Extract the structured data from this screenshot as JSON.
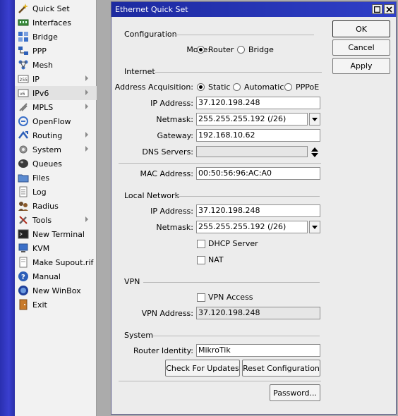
{
  "menu": [
    {
      "label": "Quick Set",
      "icon": "wand-icon",
      "arrow": false
    },
    {
      "label": "Interfaces",
      "icon": "interfaces-icon",
      "arrow": false
    },
    {
      "label": "Bridge",
      "icon": "bridge-icon",
      "arrow": false
    },
    {
      "label": "PPP",
      "icon": "ppp-icon",
      "arrow": false
    },
    {
      "label": "Mesh",
      "icon": "mesh-icon",
      "arrow": false
    },
    {
      "label": "IP",
      "icon": "ip-icon",
      "arrow": true
    },
    {
      "label": "IPv6",
      "icon": "ipv6-icon",
      "arrow": true
    },
    {
      "label": "MPLS",
      "icon": "mpls-icon",
      "arrow": true
    },
    {
      "label": "OpenFlow",
      "icon": "openflow-icon",
      "arrow": false
    },
    {
      "label": "Routing",
      "icon": "routing-icon",
      "arrow": true
    },
    {
      "label": "System",
      "icon": "gear-icon",
      "arrow": true
    },
    {
      "label": "Queues",
      "icon": "queues-icon",
      "arrow": false
    },
    {
      "label": "Files",
      "icon": "folder-icon",
      "arrow": false
    },
    {
      "label": "Log",
      "icon": "log-icon",
      "arrow": false
    },
    {
      "label": "Radius",
      "icon": "radius-icon",
      "arrow": false
    },
    {
      "label": "Tools",
      "icon": "tools-icon",
      "arrow": true
    },
    {
      "label": "New Terminal",
      "icon": "terminal-icon",
      "arrow": false
    },
    {
      "label": "KVM",
      "icon": "kvm-icon",
      "arrow": false
    },
    {
      "label": "Make Supout.rif",
      "icon": "supout-icon",
      "arrow": false
    },
    {
      "label": "Manual",
      "icon": "help-icon",
      "arrow": false
    },
    {
      "label": "New WinBox",
      "icon": "winbox-icon",
      "arrow": false
    },
    {
      "label": "Exit",
      "icon": "exit-icon",
      "arrow": false
    }
  ],
  "dialog": {
    "title": "Ethernet Quick Set",
    "buttons": {
      "ok": "OK",
      "cancel": "Cancel",
      "apply": "Apply",
      "password": "Password..."
    },
    "configuration": {
      "heading": "Configuration",
      "mode_label": "Mode:",
      "mode_options": [
        "Router",
        "Bridge"
      ],
      "mode_selected": "Router"
    },
    "internet": {
      "heading": "Internet",
      "acq_label": "Address Acquisition:",
      "acq_options": [
        "Static",
        "Automatic",
        "PPPoE"
      ],
      "acq_selected": "Static",
      "ip_label": "IP Address:",
      "ip_value": "37.120.198.248",
      "netmask_label": "Netmask:",
      "netmask_value": "255.255.255.192 (/26)",
      "gateway_label": "Gateway:",
      "gateway_value": "192.168.10.62",
      "dns_label": "DNS Servers:",
      "dns_value": "",
      "mac_label": "MAC Address:",
      "mac_value": "00:50:56:96:AC:A0"
    },
    "local": {
      "heading": "Local Network",
      "ip_label": "IP Address:",
      "ip_value": "37.120.198.248",
      "netmask_label": "Netmask:",
      "netmask_value": "255.255.255.192 (/26)",
      "dhcp_label": "DHCP Server",
      "dhcp_checked": false,
      "nat_label": "NAT",
      "nat_checked": false
    },
    "vpn": {
      "heading": "VPN",
      "access_label": "VPN Access",
      "access_checked": false,
      "address_label": "VPN Address:",
      "address_value": "37.120.198.248"
    },
    "system": {
      "heading": "System",
      "identity_label": "Router Identity:",
      "identity_value": "MikroTik",
      "check_updates": "Check For Updates",
      "reset_config": "Reset Configuration"
    }
  }
}
